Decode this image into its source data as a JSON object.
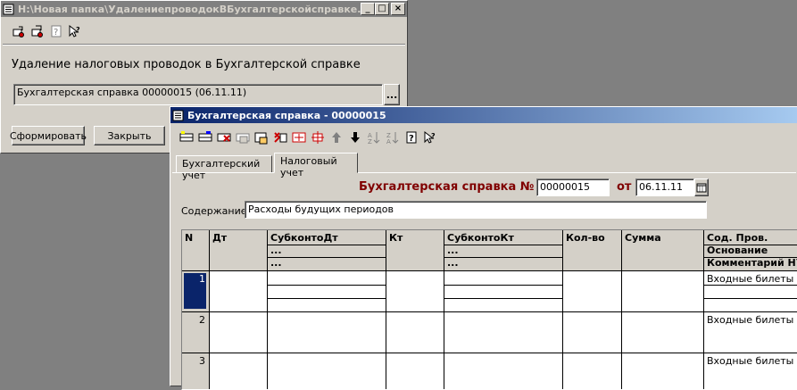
{
  "back_window": {
    "title": "H:\\Новая папка\\УдалениепроводокВБухгалтерскойсправке.ert",
    "heading": "Удаление налоговых проводок в Бухгалтерской справке",
    "doc_field_value": "Бухгалтерская справка 00000015 (06.11.11)",
    "select_button": "...",
    "generate_button": "Сформировать",
    "close_button": "Закрыть"
  },
  "front_window": {
    "title": "Бухгалтерская справка - 00000015",
    "tabs": [
      "Бухгалтерский учет",
      "Налоговый учет"
    ],
    "doc_title": "Бухгалтерская справка №",
    "doc_number": "00000015",
    "date_label": "от",
    "doc_date": "06.11.11",
    "content_label": "Содержание:",
    "content_value": "Расходы будущих периодов",
    "table": {
      "headers": {
        "n": "N",
        "dt": "Дт",
        "subkonto_dt": "СубконтоДт",
        "kt": "Кт",
        "subkonto_kt": "СубконтоКт",
        "qty": "Кол-во",
        "sum": "Сумма",
        "sod": "Сод. Пров.",
        "osnovanie": "Основание",
        "comment": "Комментарий НУ",
        "ellipsis": "..."
      },
      "rows": [
        {
          "n": "1",
          "sod": "Входные билеты"
        },
        {
          "n": "2",
          "sod": "Входные билеты"
        },
        {
          "n": "3",
          "sod": "Входные билеты"
        }
      ]
    }
  },
  "colors": {
    "title_active": "#0a246a",
    "doc_title": "#800000",
    "selected_cell": "#0a246a"
  }
}
